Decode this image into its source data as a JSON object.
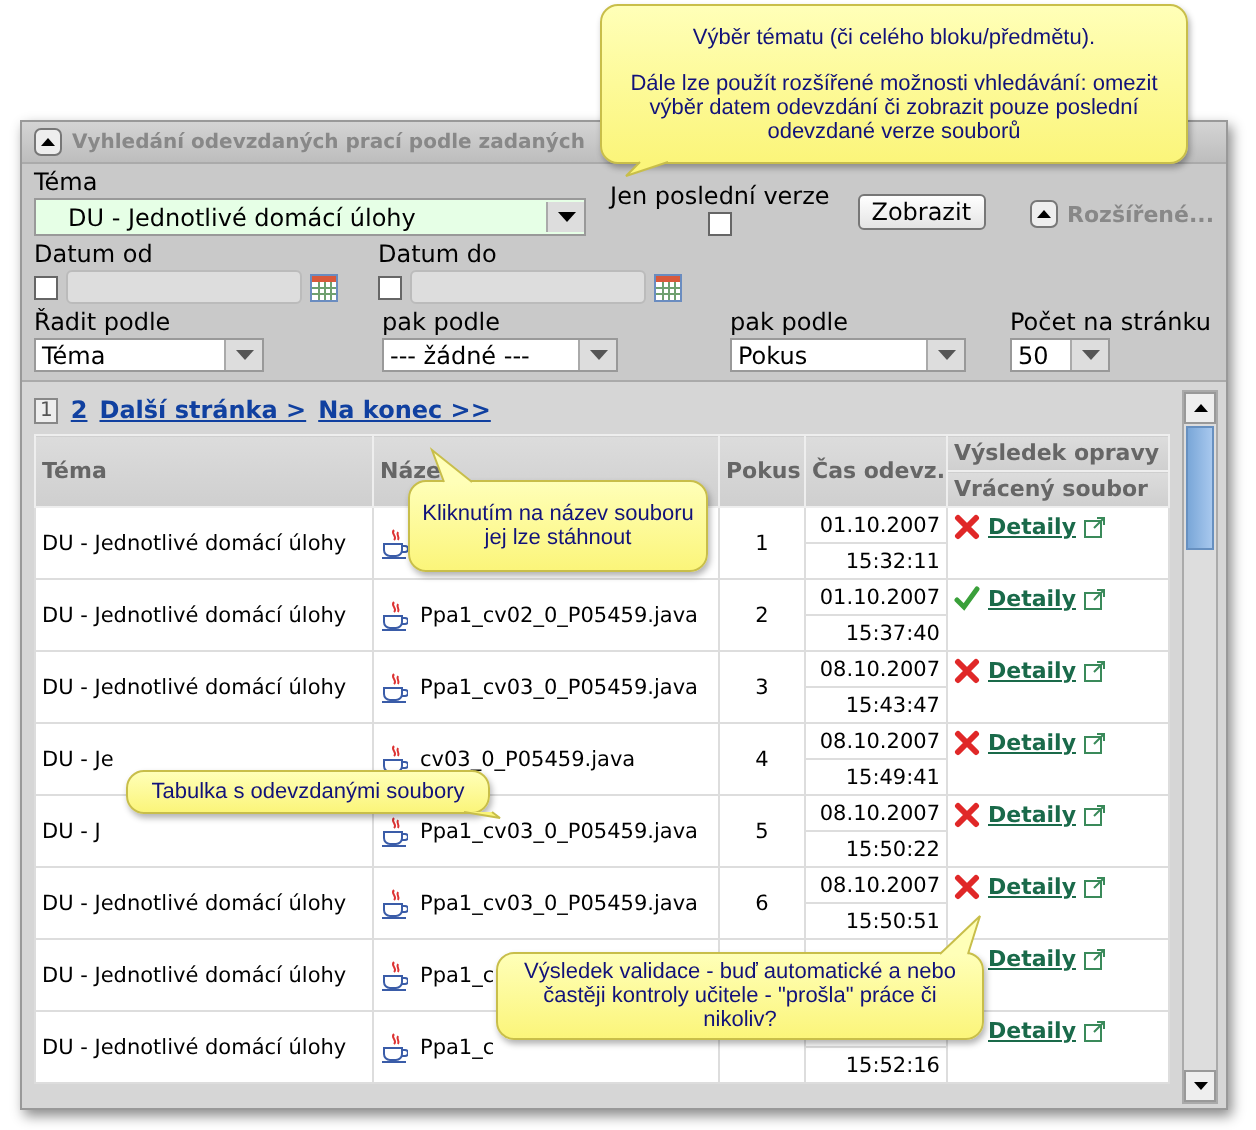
{
  "panel": {
    "title": "Vyhledání odevzdaných prací podle zadaných"
  },
  "form": {
    "topic": {
      "label": "Téma",
      "value": "DU - Jednotlivé domácí úlohy"
    },
    "last_version": {
      "label": "Jen poslední verze",
      "checked": false
    },
    "show_button": "Zobrazit",
    "advanced": "Rozšířené...",
    "date_from": {
      "label": "Datum od",
      "checked": false
    },
    "date_to": {
      "label": "Datum do",
      "checked": false
    },
    "sorts": [
      {
        "label": "Řadit podle",
        "value": "Téma"
      },
      {
        "label": "pak podle",
        "value": "--- žádné ---"
      },
      {
        "label": "pak podle",
        "value": "Pokus"
      },
      {
        "label": "Počet na stránku",
        "value": "50"
      }
    ]
  },
  "pagination": {
    "pages": [
      {
        "label": "1",
        "selected": true
      },
      {
        "label": "2",
        "selected": false
      }
    ],
    "next": "Další stránka >",
    "last": "Na konec >>"
  },
  "table": {
    "columns": [
      "Téma",
      "Náze",
      "Pokus",
      "Čas odevz."
    ],
    "result_header": [
      "Výsledek opravy",
      "Vrácený soubor"
    ],
    "rows": [
      {
        "topic": "DU - Jednotlivé domácí úlohy",
        "attempt": "1",
        "date": "01.10.2007",
        "time": "15:32:11",
        "passed": false,
        "detail": "Detaily"
      },
      {
        "topic": "DU - Jednotlivé domácí úlohy",
        "file": "Ppa1_cv02_0_P05459.java",
        "attempt": "2",
        "date": "01.10.2007",
        "time": "15:37:40",
        "passed": true,
        "detail": "Detaily"
      },
      {
        "topic": "DU - Jednotlivé domácí úlohy",
        "file": "Ppa1_cv03_0_P05459.java",
        "attempt": "3",
        "date": "08.10.2007",
        "time": "15:43:47",
        "passed": false,
        "detail": "Detaily"
      },
      {
        "topic": "DU - Je",
        "file": "cv03_0_P05459.java",
        "attempt": "4",
        "date": "08.10.2007",
        "time": "15:49:41",
        "passed": false,
        "detail": "Detaily"
      },
      {
        "topic": "DU - J",
        "file": "Ppa1_cv03_0_P05459.java",
        "attempt": "5",
        "date": "08.10.2007",
        "time": "15:50:22",
        "passed": false,
        "detail": "Detaily"
      },
      {
        "topic": "DU - Jednotlivé domácí úlohy",
        "file": "Ppa1_cv03_0_P05459.java",
        "attempt": "6",
        "date": "08.10.2007",
        "time": "15:50:51",
        "passed": false,
        "detail": "Detaily"
      },
      {
        "topic": "DU - Jednotlivé domácí úlohy",
        "file": "Ppa1_c",
        "detail": "Detaily"
      },
      {
        "topic": "DU - Jednotlivé domácí úlohy",
        "file": "Ppa1_c",
        "time": "15:52:16",
        "detail": "Detaily"
      }
    ]
  },
  "callouts": [
    {
      "kind": "up",
      "lines": [
        "Výběr tématu (či celého bloku/předmětu).",
        "Dále lze použít rozšířené možnosti vhledávání: omezit výběr datem odevzdání či zobrazit pouze poslední odevzdané verze souborů"
      ]
    },
    {
      "kind": "down",
      "lines": [
        "Kliknutím na název souboru jej lze stáhnout"
      ]
    },
    {
      "kind": "up",
      "lines": [
        "Tabulka s odevzdanými soubory"
      ]
    },
    {
      "kind": "down",
      "lines": [
        "Výsledek validace - buď automatické a nebo častěji kontroly učitele - \"prošla\" práce či nikoliv?"
      ]
    }
  ]
}
